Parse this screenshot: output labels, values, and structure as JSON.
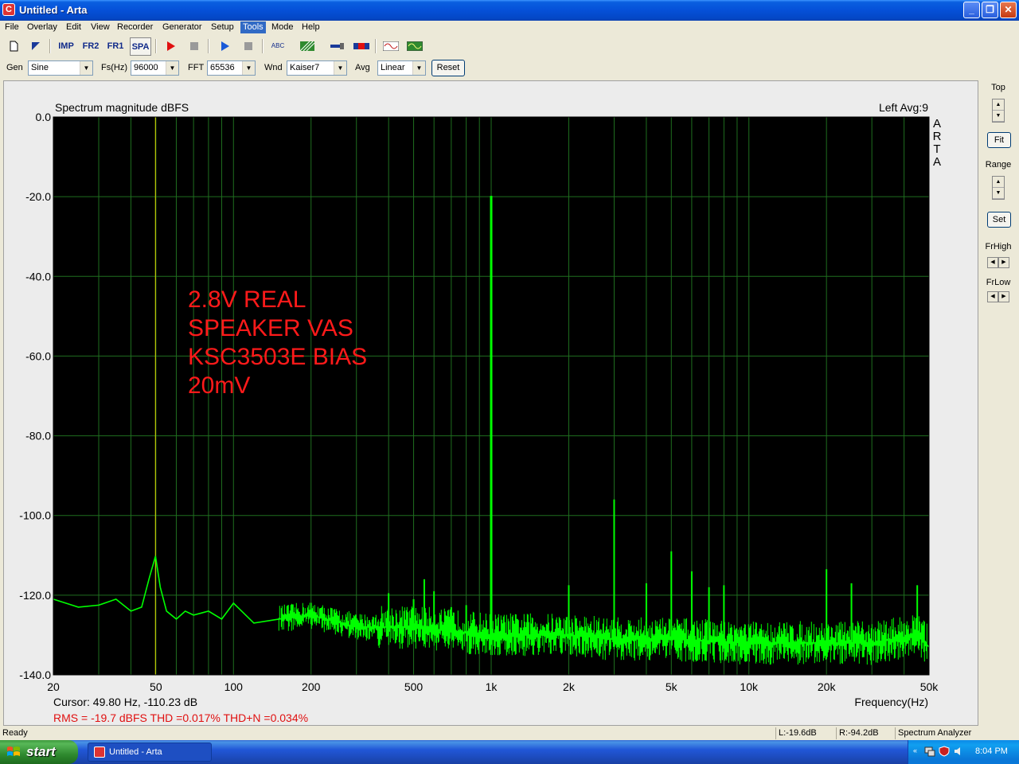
{
  "window": {
    "title": "Untitled - Arta",
    "app_icon": "C",
    "min": "_",
    "max": "❐",
    "close": "✕"
  },
  "menu": [
    "File",
    "Overlay",
    "Edit",
    "View",
    "Recorder",
    "Generator",
    "Setup",
    "Tools",
    "Mode",
    "Help"
  ],
  "toolbar": {
    "imp": "IMP",
    "fr2": "FR2",
    "fr1": "FR1",
    "spa": "SPA",
    "abc": "ABC"
  },
  "controls": {
    "gen_label": "Gen",
    "gen_value": "Sine",
    "fs_label": "Fs(Hz)",
    "fs_value": "96000",
    "fft_label": "FFT",
    "fft_value": "65536",
    "wnd_label": "Wnd",
    "wnd_value": "Kaiser7",
    "avg_label": "Avg",
    "avg_value": "Linear",
    "reset_label": "Reset"
  },
  "right_panel": {
    "top": "Top",
    "fit": "Fit",
    "range": "Range",
    "set": "Set",
    "frhigh": "FrHigh",
    "frlow": "FrLow"
  },
  "plot": {
    "title": "Spectrum magnitude dBFS",
    "channel_info": "Left  Avg:9",
    "watermark": [
      "A",
      "R",
      "T",
      "A"
    ],
    "annotation": [
      "2.8V REAL",
      "SPEAKER VAS",
      "KSC3503E BIAS",
      "20mV"
    ],
    "cursor": "Cursor: 49.80 Hz, -110.23 dB",
    "measurements": "RMS =  -19.7 dBFS   THD =0.017%   THD+N =0.034%",
    "xaxis_label": "Frequency(Hz)"
  },
  "chart_data": {
    "type": "line",
    "title": "Spectrum magnitude dBFS",
    "xlabel": "Frequency(Hz)",
    "ylabel": "",
    "xscale": "log",
    "xlim": [
      20,
      50000
    ],
    "ylim": [
      -140,
      0
    ],
    "grid": true,
    "x_tick_labels": [
      "20",
      "50",
      "100",
      "200",
      "500",
      "1k",
      "2k",
      "5k",
      "10k",
      "20k",
      "50k"
    ],
    "x_tick_values": [
      20,
      50,
      100,
      200,
      500,
      1000,
      2000,
      5000,
      10000,
      20000,
      50000
    ],
    "y_tick_labels": [
      "0.0",
      "-20.0",
      "-40.0",
      "-60.0",
      "-80.0",
      "-100.0",
      "-120.0",
      "-140.0"
    ],
    "y_tick_values": [
      0,
      -20,
      -40,
      -60,
      -80,
      -100,
      -120,
      -140
    ],
    "cursor_x": 49.8,
    "series": [
      {
        "color": "#00ff00",
        "x": [
          20,
          25,
          30,
          35,
          40,
          44,
          47,
          49.8,
          52,
          55,
          60,
          65,
          70,
          80,
          90,
          100,
          120,
          150,
          200,
          300,
          400,
          500,
          700,
          1000,
          1500,
          2000,
          3000,
          5000,
          10000,
          20000,
          30000,
          45000,
          50000
        ],
        "y": [
          -121,
          -123,
          -122.5,
          -121,
          -124,
          -123,
          -116,
          -110.2,
          -118,
          -124,
          -126,
          -124,
          -125,
          -124,
          -126,
          -122,
          -127,
          -126,
          -125,
          -128,
          -128,
          -128,
          -129,
          -130,
          -130,
          -130,
          -131,
          -131,
          -132,
          -132,
          -132,
          -130,
          -133
        ]
      }
    ],
    "peaks": [
      {
        "x": 400,
        "y": -119.5
      },
      {
        "x": 500,
        "y": -121
      },
      {
        "x": 550,
        "y": -116
      },
      {
        "x": 600,
        "y": -119
      },
      {
        "x": 700,
        "y": -123
      },
      {
        "x": 800,
        "y": -122.5
      },
      {
        "x": 1000,
        "y": -19.8
      },
      {
        "x": 2000,
        "y": -117.5
      },
      {
        "x": 3000,
        "y": -96
      },
      {
        "x": 4000,
        "y": -117
      },
      {
        "x": 5000,
        "y": -109
      },
      {
        "x": 6000,
        "y": -114
      },
      {
        "x": 7000,
        "y": -118
      },
      {
        "x": 8000,
        "y": -117.5
      },
      {
        "x": 20000,
        "y": -113.5
      },
      {
        "x": 25000,
        "y": -117
      },
      {
        "x": 45000,
        "y": -117.5
      }
    ]
  },
  "status": {
    "ready": "Ready",
    "left": "L:-19.6dB",
    "right": "R:-94.2dB",
    "mode": "Spectrum Analyzer"
  },
  "taskbar": {
    "start": "start",
    "item": "Untitled - Arta",
    "clock": "8:04 PM"
  }
}
